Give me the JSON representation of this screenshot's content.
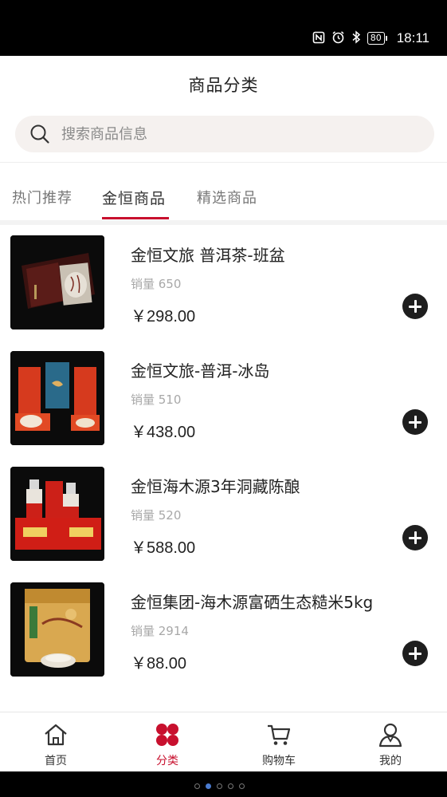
{
  "status_bar": {
    "battery_level": "80",
    "time": "18:11",
    "icons": [
      "nfc-icon",
      "alarm-icon",
      "bluetooth-icon",
      "battery-icon"
    ]
  },
  "header": {
    "title": "商品分类"
  },
  "search": {
    "placeholder": "搜索商品信息"
  },
  "tabs": [
    {
      "label": "热门推荐",
      "active": false
    },
    {
      "label": "金恒商品",
      "active": true
    },
    {
      "label": "精选商品",
      "active": false
    }
  ],
  "products": [
    {
      "name": "金恒文旅 普洱茶-班盆",
      "sales": "销量 650",
      "price": "￥298.00"
    },
    {
      "name": "金恒文旅-普洱-冰岛",
      "sales": "销量 510",
      "price": "￥438.00"
    },
    {
      "name": "金恒海木源3年洞藏陈酿",
      "sales": "销量 520",
      "price": "￥588.00"
    },
    {
      "name": "金恒集团-海木源富硒生态糙米5kg",
      "sales": "销量 2914",
      "price": "￥88.00"
    }
  ],
  "tabbar": [
    {
      "label": "首页",
      "icon": "home-icon",
      "active": false
    },
    {
      "label": "分类",
      "icon": "category-icon",
      "active": true
    },
    {
      "label": "购物车",
      "icon": "cart-icon",
      "active": false
    },
    {
      "label": "我的",
      "icon": "profile-icon",
      "active": false
    }
  ],
  "page_indicator": {
    "count": 5,
    "active_index": 1
  },
  "colors": {
    "accent": "#c8102e",
    "search_bg": "#f5f1ef",
    "add_button": "#1e1e1e"
  }
}
